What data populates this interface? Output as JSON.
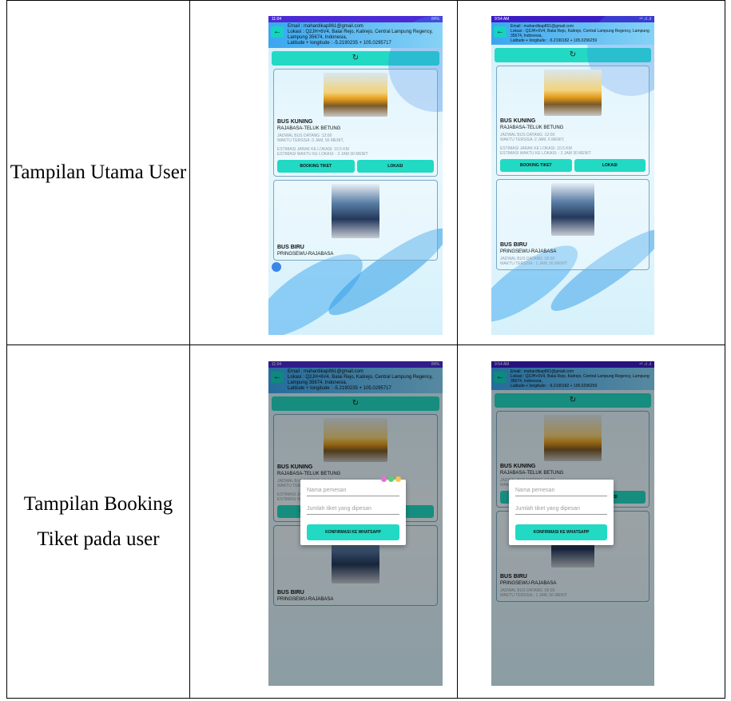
{
  "rows": [
    {
      "label": "Tampilan Utama User"
    },
    {
      "label": "Tampilan Booking Tiket pada user"
    }
  ],
  "screens": {
    "left": {
      "time": "11:04",
      "status_icons": "84%",
      "email": "Email : mahardikap861@gmail.com",
      "lokasi": "Lokasi : Q2JH+6V4, Balai Rejo, Kalirejo, Central Lampung Regency, Lampung 35674, Indonesia,",
      "latlng": "Latitude + longitude : -5.2190235 + 105.0295717",
      "refresh_icon": "↻"
    },
    "right": {
      "time": "9:54 AM",
      "status_icons": "⁴ᴳ .ıl .ıl",
      "email": "Email : mahardikap861@gmail.com",
      "lokasi": "Lokasi : Q2JH+6V4, Balai Rejo, Kalirejo, Central Lampung Regency, Lampung 35674, Indonesia,",
      "latlng": "Latitude + longitude : -5.2190182 + 105.0296259",
      "refresh_icon": "↻"
    }
  },
  "cards": {
    "kuning": {
      "name": "BUS KUNING",
      "route": "RAJABASA-TELUK BETUNG",
      "jadwal": "JADWAL BUS DATANG :12:00",
      "waktu_left": "WAKTU TERSISA :3 JAM, 56 MENIT,",
      "waktu_right": "WAKTU TERSISA :2 JAM, 6 MENIT,",
      "jarak": "ESTIMASI JARAK KE LOKASI: 10.5 KM",
      "estimasi": "ESTIMASI WAKTU KE LOKASI: : 2 JAM 30 MENIT",
      "booking": "BOOKING TIKET",
      "lokasi": "LOKASI"
    },
    "biru": {
      "name": "BUS BIRU",
      "route_left": "PRINGSEWU-RAJABASA",
      "route_right": "PRINGSEWU-RAJABASA",
      "jadwal": "JADWAL BUS DATANG :02:00",
      "waktu": "WAKTU TERSISA : 1 JAM, 56 MENIT"
    }
  },
  "dialog": {
    "nama_placeholder": "Nama pemesan",
    "jumlah_placeholder": "Jumlah tiket yang dipesan",
    "confirm": "KONFIRMASI KE WHATSAPP",
    "dot_colors": [
      "#ef6cd6",
      "#4fd66a",
      "#f2c94c"
    ]
  },
  "colors": {
    "accent": "#22d9c4",
    "statusbar": "#4b2bd6"
  }
}
